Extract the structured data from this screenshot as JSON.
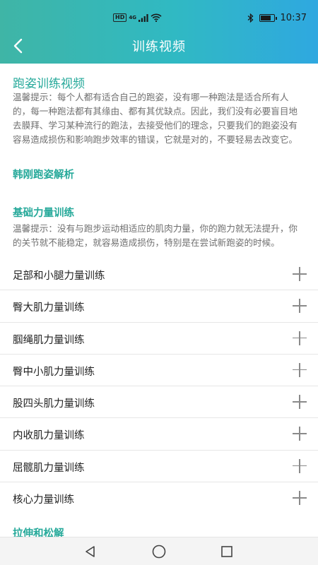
{
  "status_bar": {
    "network_badge": "HD",
    "network_type": "4G",
    "time": "10:37",
    "battery_level": 0.85,
    "icons": [
      "signal-icon",
      "wifi-icon",
      "bluetooth-icon",
      "battery-icon"
    ]
  },
  "header": {
    "title": "训练视频",
    "back_icon": "chevron-left-icon"
  },
  "section_running": {
    "title": "跑姿训练视频",
    "tip": "温馨提示：每个人都有适合自己的跑姿，没有哪一种跑法是适合所有人的，每一种跑法都有其缘由、都有其优缺点。因此，我们没有必要盲目地去膜拜、学习某种流行的跑法，去接受他们的理念，只要我们的跑姿没有容易造成损伤和影响跑步效率的错误，它就是对的，不要轻易去改变它。",
    "link": "韩刚跑姿解析"
  },
  "section_strength": {
    "title": "基础力量训练",
    "tip": "温馨提示：没有与跑步运动相适应的肌肉力量，你的跑力就无法提升，你的关节就不能稳定，就容易造成损伤，特别是在尝试新跑姿的时候。",
    "items": [
      {
        "label": "足部和小腿力量训练"
      },
      {
        "label": "臀大肌力量训练"
      },
      {
        "label": "腘绳肌力量训练"
      },
      {
        "label": "臀中小肌力量训练"
      },
      {
        "label": "股四头肌力量训练"
      },
      {
        "label": "内收肌力量训练"
      },
      {
        "label": "屈髋肌力量训练"
      },
      {
        "label": "核心力量训练"
      }
    ]
  },
  "section_stretch": {
    "title": "拉伸和松解"
  },
  "colors": {
    "accent": "#26a99a",
    "header_gradient_start": "#3fb5a6",
    "header_gradient_end": "#2fa8e0"
  },
  "bottom_nav": {
    "icons": [
      "back-triangle-icon",
      "home-circle-icon",
      "recent-square-icon"
    ]
  }
}
